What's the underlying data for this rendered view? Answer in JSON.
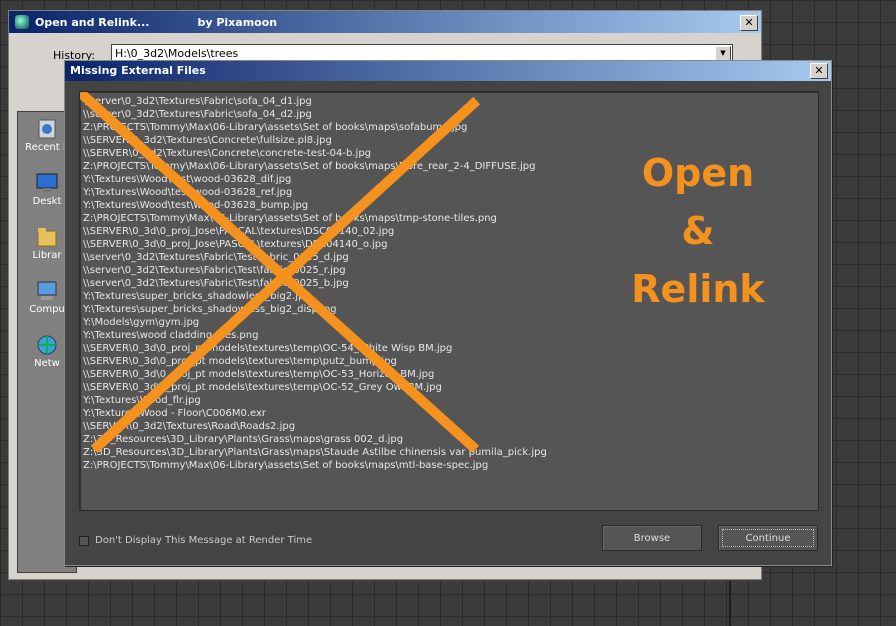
{
  "back_dialog": {
    "title": "Open and Relink...",
    "subtitle": "by Pixamoon",
    "close_glyph": "✕",
    "history_label": "History:",
    "history_value": "H:\\0_3d2\\Models\\trees",
    "places": [
      {
        "label": "Recent P",
        "icon": "recent-places-icon"
      },
      {
        "label": "Deskt",
        "icon": "desktop-icon"
      },
      {
        "label": "Librar",
        "icon": "libraries-icon"
      },
      {
        "label": "Compu",
        "icon": "computer-icon"
      },
      {
        "label": "Netw",
        "icon": "network-icon"
      }
    ]
  },
  "dialog": {
    "title": "Missing External Files",
    "close_glyph": "✕",
    "files": [
      "\\\\server\\0_3d2\\Textures\\Fabric\\sofa_04_d1.jpg",
      "\\\\server\\0_3d2\\Textures\\Fabric\\sofa_04_d2.jpg",
      "Z:\\PROJECTS\\Tommy\\Max\\06-Library\\assets\\Set of  books\\maps\\sofabump.jpg",
      "\\\\SERVER\\0_3d2\\Textures\\Concrete\\fullsize.pl8.jpg",
      "\\\\SERVER\\0_3d2\\Textures\\Concrete\\concrete-test-04-b.jpg",
      "Z:\\PROJECTS\\Tommy\\Max\\06-Library\\assets\\Set of  books\\maps\\Fibre_rear_2-4_DIFFUSE.jpg",
      "Y:\\Textures\\Wood\\test\\wood-03628_dif.jpg",
      "Y:\\Textures\\Wood\\test\\wood-03628_ref.jpg",
      "Y:\\Textures\\Wood\\test\\wood-03628_bump.jpg",
      "Z:\\PROJECTS\\Tommy\\Max\\06-Library\\assets\\Set of  books\\maps\\tmp-stone-tiles.png",
      "\\\\SERVER\\0_3d\\0_proj_Jose\\PASCAL\\textures\\DSC04140_02.jpg",
      "\\\\SERVER\\0_3d\\0_proj_Jose\\PASCAL\\textures\\DSC04140_o.jpg",
      "\\\\server\\0_3d2\\Textures\\Fabric\\Test\\fabric_0025_d.jpg",
      "\\\\server\\0_3d2\\Textures\\Fabric\\Test\\fabric_0025_r.jpg",
      "\\\\server\\0_3d2\\Textures\\Fabric\\Test\\fabric_0025_b.jpg",
      "Y:\\Textures\\super_bricks_shadowless_big2.jpg",
      "Y:\\Textures\\super_bricks_shadowless_big2_disp.jpg",
      "Y:\\Models\\gym\\gym.jpg",
      "Y:\\Textures\\wood cladding tiles.png",
      "\\\\SERVER\\0_3d\\0_proj_pt models\\textures\\temp\\OC-54_White Wisp BM.jpg",
      "\\\\SERVER\\0_3d\\0_proj_pt models\\textures\\temp\\putz_bump.jpg",
      "\\\\SERVER\\0_3d\\0_proj_pt models\\textures\\temp\\OC-53_Horizon BM.jpg",
      "\\\\SERVER\\0_3d\\0_proj_pt models\\textures\\temp\\OC-52_Grey Owl BM.jpg",
      "Y:\\Textures\\Wood_flr.jpg",
      "Y:\\Textures\\Wood - Floor\\C006M0.exr",
      "\\\\SERVER\\0_3d2\\Textures\\Road\\Roads2.jpg",
      "Z:\\3D_Resources\\3D_Library\\Plants\\Grass\\maps\\grass 002_d.jpg",
      "Z:\\3D_Resources\\3D_Library\\Plants\\Grass\\maps\\Staude Astilbe chinensis var pumila_pick.jpg",
      "Z:\\PROJECTS\\Tommy\\Max\\06-Library\\assets\\Set of  books\\maps\\mtl-base-spec.jpg"
    ],
    "overlay": {
      "line1": "Open",
      "line2": "&",
      "line3": "Relink",
      "color": "#f5921e"
    },
    "checkbox_label": "Don't Display This Message at Render Time",
    "checkbox_checked": false,
    "browse_label": "Browse",
    "continue_label": "Continue"
  }
}
